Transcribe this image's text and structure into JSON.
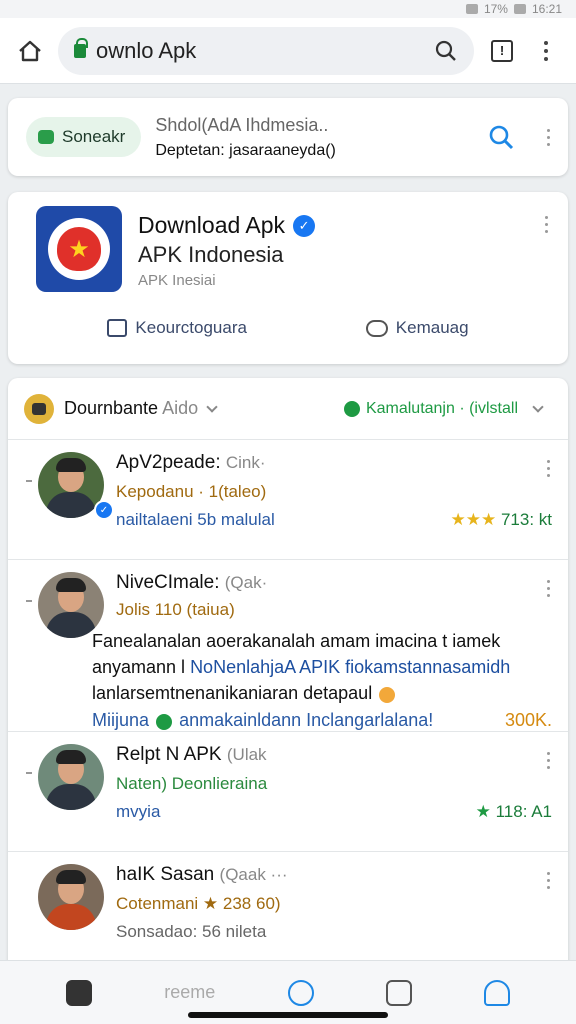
{
  "status_bar": {
    "battery": "17%",
    "time": "16:21"
  },
  "browser": {
    "url": "ownlo Apk"
  },
  "search": {
    "chip_label": "Soneakr",
    "query": "Shdol(AdA Ihdmesia..",
    "subtitle": "Deptetan: jasaraaneyda()"
  },
  "app": {
    "title": "Download Apk",
    "subtitle": "APK Indonesia",
    "meta": "APK Inesiai",
    "action_like": "Keourctoguara",
    "action_comment": "Kemauag"
  },
  "list": {
    "sort_label": "Dournbante",
    "sort_value": "Aido",
    "filter_label": "Kamalutanjn · (ivlstall"
  },
  "reviews": [
    {
      "name": "ApV2peade:",
      "tag": "Cink·",
      "line2": "Kepodanu · 1(taleo)",
      "footer_left": "nailtalaeni 5b malulal",
      "rating_stars": "★★★",
      "rating_value": "713: kt"
    },
    {
      "name": "NiveCImale:",
      "tag": "(Qak·",
      "line2": "Jolis  110 (taiua)",
      "body_1": "Fanealanalan aoerakanalah amam imacina t iamek",
      "body_2_a": "anyamann l ",
      "body_2_b": "NoNenlahjaA APIK fiokamstannasamidh",
      "body_3": "lanlarsemtnenanikaniaran detapaul",
      "body_4_a": "Miijuna",
      "body_4_b": "anmakainldann Inclangarlalana!",
      "rating_value": "300K."
    },
    {
      "name": "Relpt N APK",
      "tag": "(Ulak",
      "line2": "Naten)  Deonlieraina",
      "footer_left": "mvyia",
      "rating_stars": "★",
      "rating_value": "118: A1"
    },
    {
      "name": "haIK Sasan",
      "tag": "(Qaak ···",
      "line2": "Cotenmani ★ 238 60)",
      "footer_left": "Sonsadao: 56 nileta"
    }
  ],
  "bottom_nav": {
    "label": "reeme"
  }
}
